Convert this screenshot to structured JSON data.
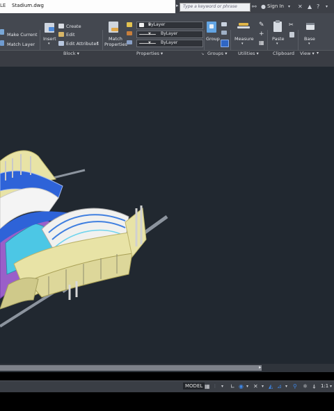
{
  "titlebar": {
    "app_fragment": "LE",
    "document": "Stadium.dwg",
    "search_placeholder": "Type a keyword or phrase",
    "sign_in": "Sign In"
  },
  "ribbon": {
    "block": {
      "make_current": "Make Current",
      "match_layer": "Match Layer",
      "insert": "Insert",
      "create": "Create",
      "edit": "Edit",
      "edit_attributes": "Edit Attributes",
      "title": "Block"
    },
    "properties": {
      "match_properties_line1": "Match",
      "match_properties_line2": "Properties",
      "color": "ByLayer",
      "linetype": "ByLayer",
      "lineweight": "ByLayer",
      "title": "Properties"
    },
    "groups": {
      "group": "Group",
      "title": "Groups"
    },
    "utilities": {
      "measure": "Measure",
      "title": "Utilities"
    },
    "clipboard": {
      "paste": "Paste",
      "title": "Clipboard"
    },
    "view": {
      "base": "Base",
      "title": "View"
    }
  },
  "statusbar": {
    "model": "MODEL",
    "scale": "1:1"
  },
  "colors": {
    "background": "#212830",
    "model_yellow": "#e8e3a6",
    "model_blue": "#2e63d8",
    "model_purple": "#9a5fc9",
    "model_cyan": "#4cc7e5"
  }
}
